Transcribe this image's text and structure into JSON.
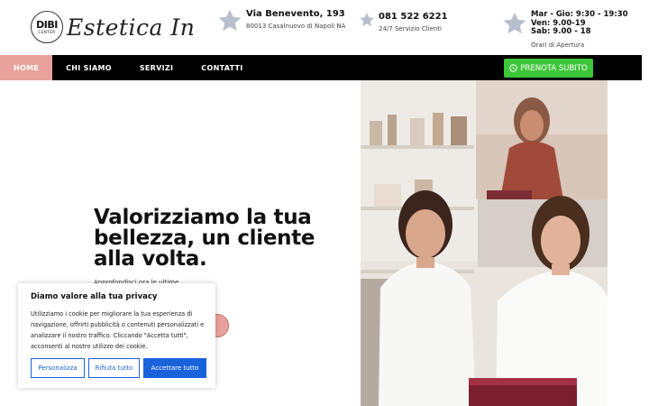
{
  "brand": {
    "badge_big": "DIBI",
    "badge_small": "CENTER",
    "script_name": "Estetica In"
  },
  "header": {
    "address": {
      "icon": "star-icon",
      "title": "Via Benevento, 193",
      "subtitle": "80013 Casalnuovo di Napoli NA"
    },
    "phone": {
      "icon": "star-icon",
      "title": "081 522 6221",
      "subtitle": "24/7 Servizio Clienti"
    },
    "hours": {
      "icon": "star-icon",
      "line1": "Mar - Gio: 9:30 - 19:30",
      "line2": "Ven: 9.00-19",
      "line3": "Sab: 9.00 - 18",
      "subtitle": "Orari di Apertura"
    }
  },
  "nav": {
    "items": [
      {
        "label": "HOME",
        "active": true
      },
      {
        "label": "CHI SIAMO",
        "active": false
      },
      {
        "label": "SERVIZI",
        "active": false
      },
      {
        "label": "CONTATTI",
        "active": false
      }
    ],
    "book_button": {
      "icon": "whatsapp-icon",
      "label": "PRENOTA SUBITO"
    }
  },
  "hero": {
    "title": "Valorizziamo la tua bellezza, un cliente alla volta.",
    "subtitle": "Approfondisci ora le ultime"
  },
  "cookie": {
    "title": "Diamo valore alla tua privacy",
    "text": "Utilizziamo i cookie per migliorare la tua esperienza di navigazione, offrirti pubblicità o contenuti personalizzati e analizzare il nostro traffico. Cliccando \"Accetta tutti\", acconsenti al nostro utilizzo dei cookie.",
    "customize": "Personalizza",
    "reject": "Rifiuta tutto",
    "accept": "Accettare tutto"
  },
  "colors": {
    "accent_pink": "#e8a29b",
    "nav_bg": "#000000",
    "whatsapp_green": "#3ec63a",
    "cookie_blue": "#1863dc",
    "star_gray": "#b8bfcc"
  }
}
